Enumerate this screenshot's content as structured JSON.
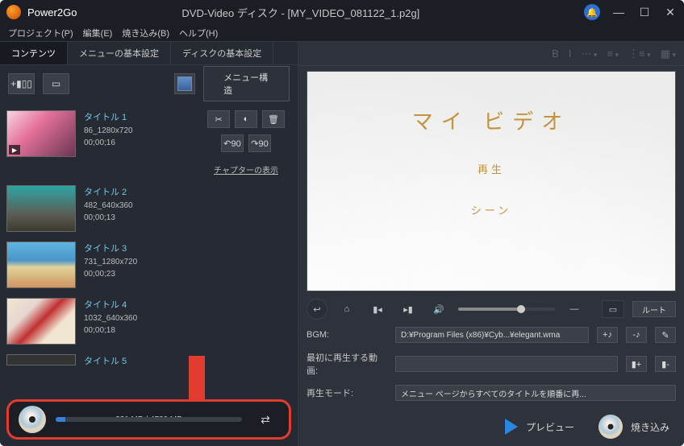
{
  "titlebar": {
    "app_name": "Power2Go",
    "window_title": "DVD-Video ディスク - [MY_VIDEO_081122_1.p2g]",
    "min": "—",
    "max": "☐",
    "close": "✕"
  },
  "menubar": {
    "project": "プロジェクト(P)",
    "edit": "編集(E)",
    "burn": "焼き込み(B)",
    "help": "ヘルプ(H)"
  },
  "tabs": {
    "content": "コンテンツ",
    "menu_basic": "メニューの基本設定",
    "disc_basic": "ディスクの基本設定"
  },
  "toolbar": {
    "add": "+▮▯▯",
    "blank": "▭",
    "menu_structure": "メニュー構造"
  },
  "item_controls": {
    "cut": "✂",
    "contrast": "◐",
    "delete": "🗑",
    "rotate_ccw": "↶90",
    "rotate_cw": "↷90",
    "chapter_link": "チャプターの表示"
  },
  "titles": [
    {
      "name": "タイトル 1",
      "res": "86_1280x720",
      "dur": "00;00;16"
    },
    {
      "name": "タイトル 2",
      "res": "482_640x360",
      "dur": "00;00;13"
    },
    {
      "name": "タイトル 3",
      "res": "731_1280x720",
      "dur": "00;00;23"
    },
    {
      "name": "タイトル 4",
      "res": "1032_640x360",
      "dur": "00;00;18"
    },
    {
      "name": "タイトル 5",
      "res": "",
      "dur": ""
    }
  ],
  "disc": {
    "label": "221 MB / 4700 MB",
    "swap": "⇄"
  },
  "format_toolbar": {
    "bold": "B",
    "italic": "I",
    "font": "⋯",
    "align": "≡",
    "list": "⋮≡",
    "grid": "▦"
  },
  "preview": {
    "title": "マイ ビデオ",
    "play": "再生",
    "scene": "シーン"
  },
  "player": {
    "back": "↩",
    "home": "⌂",
    "prev": "▮◂",
    "next": "▸▮",
    "vol": "🔊",
    "mask": "—",
    "screen": "▭",
    "root": "ルート"
  },
  "settings": {
    "bgm_label": "BGM:",
    "bgm_value": "D:¥Program Files (x86)¥Cyb...¥elegant.wma",
    "first_label": "最初に再生する動画:",
    "first_value": "",
    "mode_label": "再生モード:",
    "mode_value": "メニュー ページからすべてのタイトルを順番に再...",
    "note_add": "+♪",
    "note_del": "-♪",
    "edit": "✎",
    "film_add": "▮+",
    "film_del": "▮-"
  },
  "footer": {
    "preview": "プレビュー",
    "burn": "焼き込み"
  }
}
